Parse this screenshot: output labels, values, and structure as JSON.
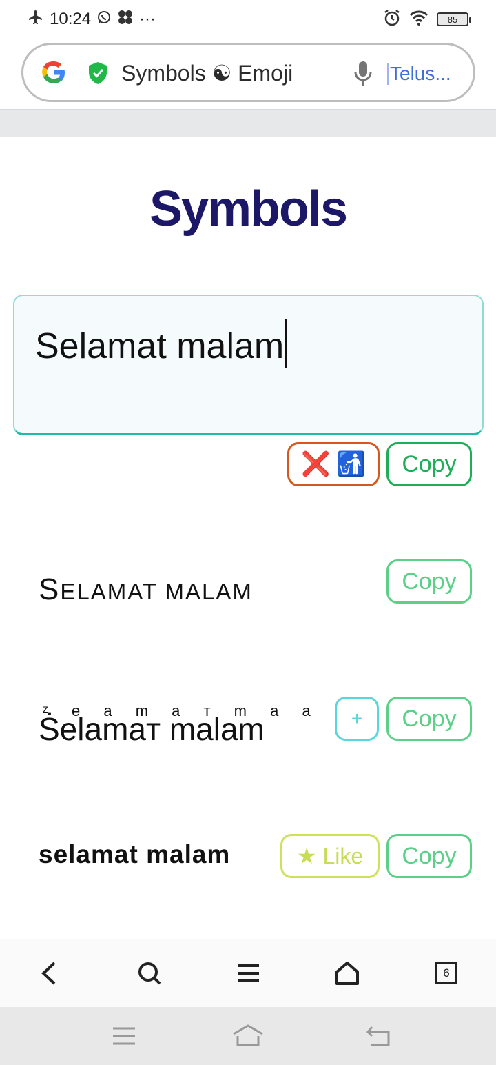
{
  "status_bar": {
    "time": "10:24",
    "dots": "···",
    "battery": "85"
  },
  "address_bar": {
    "page_title": "Symbols ☯ Emoji",
    "side_text": "Telus..."
  },
  "page": {
    "title": "Symbols",
    "text_box_value": "Selamat malam",
    "clear_button_label": "❌ 🚮",
    "copy_label": "Copy",
    "variants": [
      {
        "first": "S",
        "rest": "ELAMAT MALAM"
      },
      {
        "top": "ᶻ e a m a ᴛ  m a a m",
        "main": "Ṡelamaт malam"
      },
      {
        "text": "selamat malam"
      }
    ],
    "plus_label": "+",
    "like_label": "★ Like"
  },
  "browser_nav": {
    "tab_count": "6"
  },
  "colors": {
    "title": "#1c1766",
    "copy_green": "#1fae57",
    "clear_orange": "#d4581f",
    "plus_cyan": "#5ad6dd",
    "like_yellow": "#cfe15a"
  }
}
